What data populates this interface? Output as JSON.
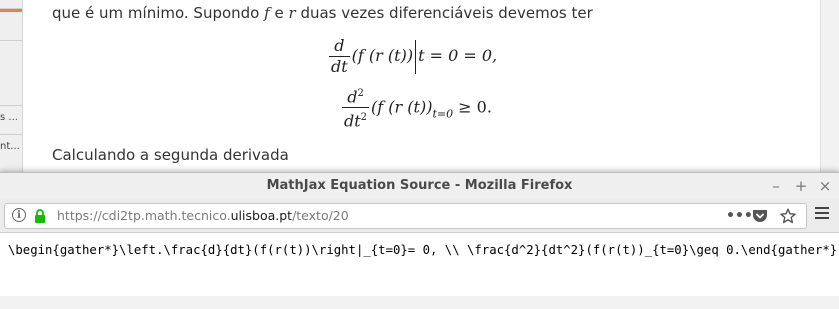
{
  "background_page": {
    "sidebar_tabs": [
      "s ...",
      "nt..."
    ],
    "intro_text_before": "que é um mínimo. Supondo",
    "var_f": "f",
    "conj_e": "e",
    "var_r": "r",
    "intro_text_after": "duas vezes diferenciáveis devemos ter",
    "eq1": {
      "num": "d",
      "den": "dt",
      "body": "(f (r (t))",
      "rest": "t = 0 = 0,"
    },
    "eq2": {
      "num": "d",
      "num_sup": "2",
      "den": "dt",
      "den_sup": "2",
      "body": "(f (r (t))",
      "sub": "t=0",
      "rest": "≥ 0."
    },
    "next_text": "Calculando a segunda derivada"
  },
  "popup": {
    "title": "MathJax Equation Source - Mozilla Firefox",
    "controls": {
      "minimize": "–",
      "maximize": "+",
      "close": "×"
    },
    "url_prefix": "https://cdi2tp.math.tecnico.",
    "url_host": "ulisboa.pt",
    "url_path": "/texto/20",
    "icons": [
      "info-icon",
      "lock-icon",
      "page-actions-icon",
      "pocket-icon",
      "bookmark-star-icon",
      "hamburger-menu-icon"
    ],
    "source_text": "\\begin{gather*}\\left.\\frac{d}{dt}(f(r(t))\\right|_{t=0}= 0, \\\\ \\frac{d^2}{dt^2}(f(r(t))_{t=0}\\geq 0.\\end{gather*}"
  },
  "colors": {
    "lock_green": "#12bc00",
    "sidebar_accent": "#e57d5f"
  }
}
